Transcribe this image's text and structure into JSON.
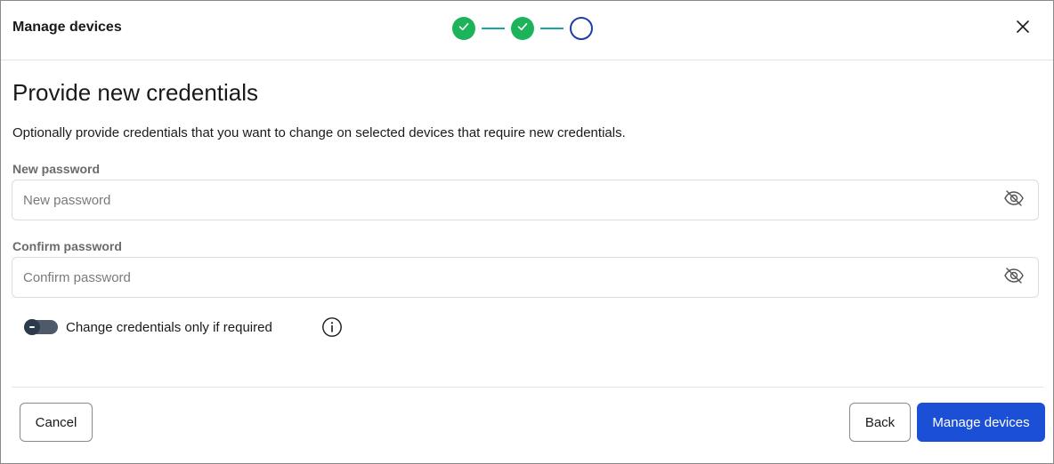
{
  "dialog": {
    "title": "Manage devices"
  },
  "stepper": {
    "steps": [
      {
        "status": "completed",
        "icon": "check-icon"
      },
      {
        "status": "completed",
        "icon": "check-icon"
      },
      {
        "status": "current",
        "icon": ""
      }
    ],
    "colors": {
      "completed": "#1db35a",
      "connector": "#1aa5a0",
      "current": "#1c3faa"
    }
  },
  "page": {
    "heading": "Provide new credentials",
    "description": "Optionally provide credentials that you want to change on selected devices that require new credentials."
  },
  "form": {
    "new_password": {
      "label": "New password",
      "placeholder": "New password",
      "value": "",
      "visibility_icon": "eye-off-icon"
    },
    "confirm_password": {
      "label": "Confirm password",
      "placeholder": "Confirm password",
      "value": "",
      "visibility_icon": "eye-off-icon"
    },
    "toggle": {
      "label": "Change credentials only if required",
      "checked": false,
      "info_icon": "info-icon"
    }
  },
  "footer": {
    "cancel_label": "Cancel",
    "back_label": "Back",
    "submit_label": "Manage devices",
    "primary_color": "#1a4fd6"
  }
}
